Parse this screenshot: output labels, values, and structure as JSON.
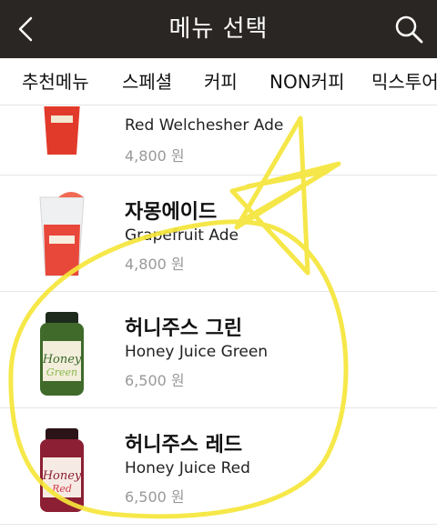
{
  "header": {
    "title": "메뉴 선택",
    "back_icon": "chevron-left-icon",
    "search_icon": "search-icon",
    "background": "#2a2623"
  },
  "tabs": [
    {
      "label": "추천메뉴"
    },
    {
      "label": "스페셜"
    },
    {
      "label": "커피"
    },
    {
      "label": "NON커피"
    },
    {
      "label": "믹스투어"
    }
  ],
  "menu_items": [
    {
      "name_ko": "",
      "name_en": "Red Welchesher Ade",
      "price": "4,800 원"
    },
    {
      "name_ko": "자몽에이드",
      "name_en": "Grapefruit Ade",
      "price": "4,800 원"
    },
    {
      "name_ko": "허니주스 그린",
      "name_en": "Honey Juice Green",
      "price": "6,500 원"
    },
    {
      "name_ko": "허니주스 레드",
      "name_en": "Honey Juice Red",
      "price": "6,500 원"
    }
  ],
  "annotation": {
    "color": "#f5e63a"
  }
}
